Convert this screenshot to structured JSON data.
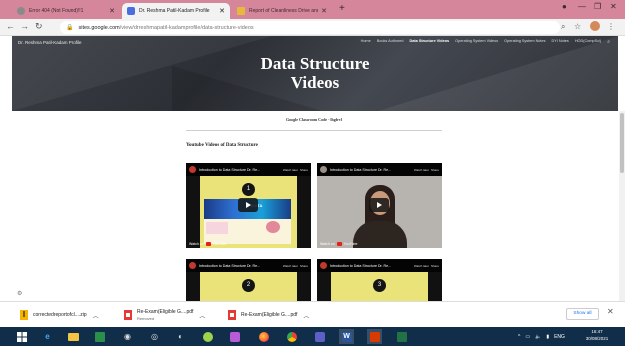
{
  "browser": {
    "tabs": [
      {
        "title": "Error 404 (Not Found)!!1",
        "favicon_color": "#8a8a8a",
        "active": false
      },
      {
        "title": "Dr. Reshma Patil-Kadam Profile",
        "favicon_color": "#4a6ee0",
        "active": true
      },
      {
        "title": "Report of Cleanliness Drive and",
        "favicon_color": "#e8b83a",
        "active": false
      }
    ],
    "new_tab_label": "+",
    "address": {
      "host": "sites.google.com",
      "path": "/view/drreshmapatil-kadamprofile/data-structure-videos"
    }
  },
  "site": {
    "name": "Dr. Reshma Patil-Kadam Profile",
    "nav": [
      "Home",
      "Books Authored",
      "Data Structure Videos",
      "Operating System Videos",
      "Operating System Notes",
      "DYI Notes",
      "HOD(CompSci)"
    ],
    "active_nav": "Data Structure Videos",
    "title_line1": "Data Structure",
    "title_line2": "Videos"
  },
  "content": {
    "classroom_code": "Google Classroom Code - lhgfrvl",
    "section_heading": "Youtube Videos of Data Structure",
    "videos": [
      {
        "title": "Introduction to Data Structure Dr. Re...",
        "number": "1",
        "watch_label": "Watch on",
        "yt_label": "YouTube",
        "kind": "slide",
        "banner_text": "DATA"
      },
      {
        "title": "Introduction to Data Structure Dr. Re...",
        "number": "",
        "watch_label": "Watch on",
        "yt_label": "YouTube",
        "kind": "webcam",
        "banner_text": ""
      },
      {
        "title": "Introduction to Data Structure Dr. Re...",
        "number": "2",
        "watch_label": "",
        "yt_label": "",
        "kind": "slide",
        "banner_text": ""
      },
      {
        "title": "Introduction to Data Structure Dr. Re...",
        "number": "3",
        "watch_label": "",
        "yt_label": "",
        "kind": "slide",
        "banner_text": ""
      }
    ],
    "video_action_labels": [
      "Watch later",
      "Share"
    ]
  },
  "downloads": {
    "items": [
      {
        "name": "correctedreportofcl....zip",
        "status": "",
        "icon": "zip-icon"
      },
      {
        "name": "Re-Exam(Eligible G....pdf",
        "status": "Removed",
        "icon": "pdf-icon"
      },
      {
        "name": "Re-Exam(Eligible G....pdf",
        "status": "",
        "icon": "pdf-icon"
      }
    ],
    "show_all_label": "Show all"
  },
  "taskbar": {
    "language": "ENG",
    "time": "16:47",
    "date": "30/08/2021"
  },
  "colors": {
    "tabstrip": "#d6869b",
    "hero_dark": "#3b3e45",
    "taskbar": "#102d4a",
    "link_blue": "#1a73e8"
  }
}
